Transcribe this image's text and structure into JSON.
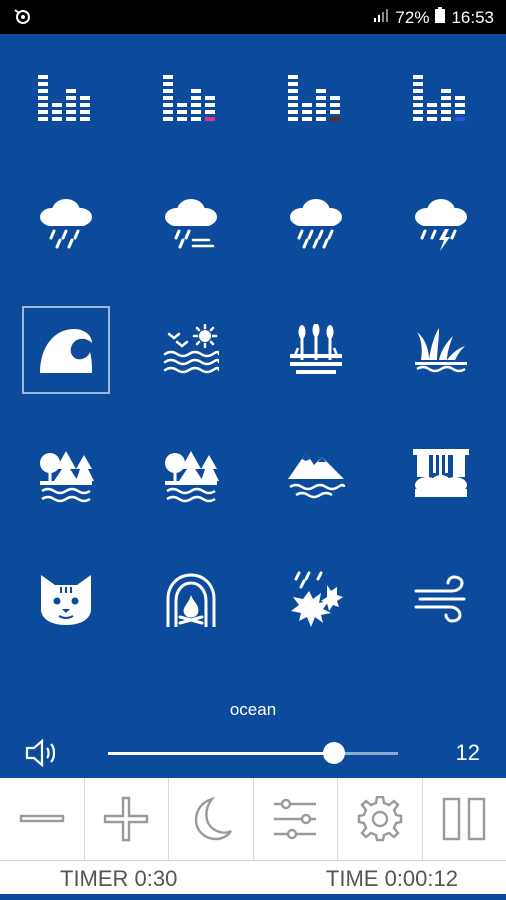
{
  "status_bar": {
    "battery": "72%",
    "clock": "16:53",
    "icons": [
      "app-notification-icon",
      "signal-icon",
      "battery-icon"
    ]
  },
  "sounds": [
    {
      "icon": "equalizer-icon"
    },
    {
      "icon": "equalizer-pink-icon",
      "accent": "#e0308a"
    },
    {
      "icon": "equalizer-brown-icon",
      "accent": "#5a3018"
    },
    {
      "icon": "equalizer-blue-icon",
      "accent": "#3a4fd8"
    },
    {
      "icon": "rain-icon"
    },
    {
      "icon": "rain-wind-icon"
    },
    {
      "icon": "heavy-rain-icon"
    },
    {
      "icon": "thunderstorm-icon"
    },
    {
      "icon": "ocean-wave-icon",
      "selected": true
    },
    {
      "icon": "birds-sea-sun-icon"
    },
    {
      "icon": "marsh-reeds-icon"
    },
    {
      "icon": "grass-water-icon"
    },
    {
      "icon": "forest-lake-icon"
    },
    {
      "icon": "forest-river-icon"
    },
    {
      "icon": "mountain-lake-icon"
    },
    {
      "icon": "waterfall-icon"
    },
    {
      "icon": "cat-icon"
    },
    {
      "icon": "fireplace-icon"
    },
    {
      "icon": "leaves-rain-icon"
    },
    {
      "icon": "wind-icon"
    }
  ],
  "current_sound": "ocean",
  "volume": {
    "value": "12",
    "level_fraction": 0.78
  },
  "toolbar": {
    "buttons": [
      "minus-icon",
      "plus-icon",
      "moon-icon",
      "equalizer-sliders-icon",
      "gear-icon",
      "pause-icon"
    ]
  },
  "footer": {
    "timer": "TIMER  0:30",
    "time": "TIME  0:00:12"
  },
  "colors": {
    "background": "#0c4b9c",
    "toolbar": "#ffffff",
    "icon_gray": "#9a9a9a"
  }
}
